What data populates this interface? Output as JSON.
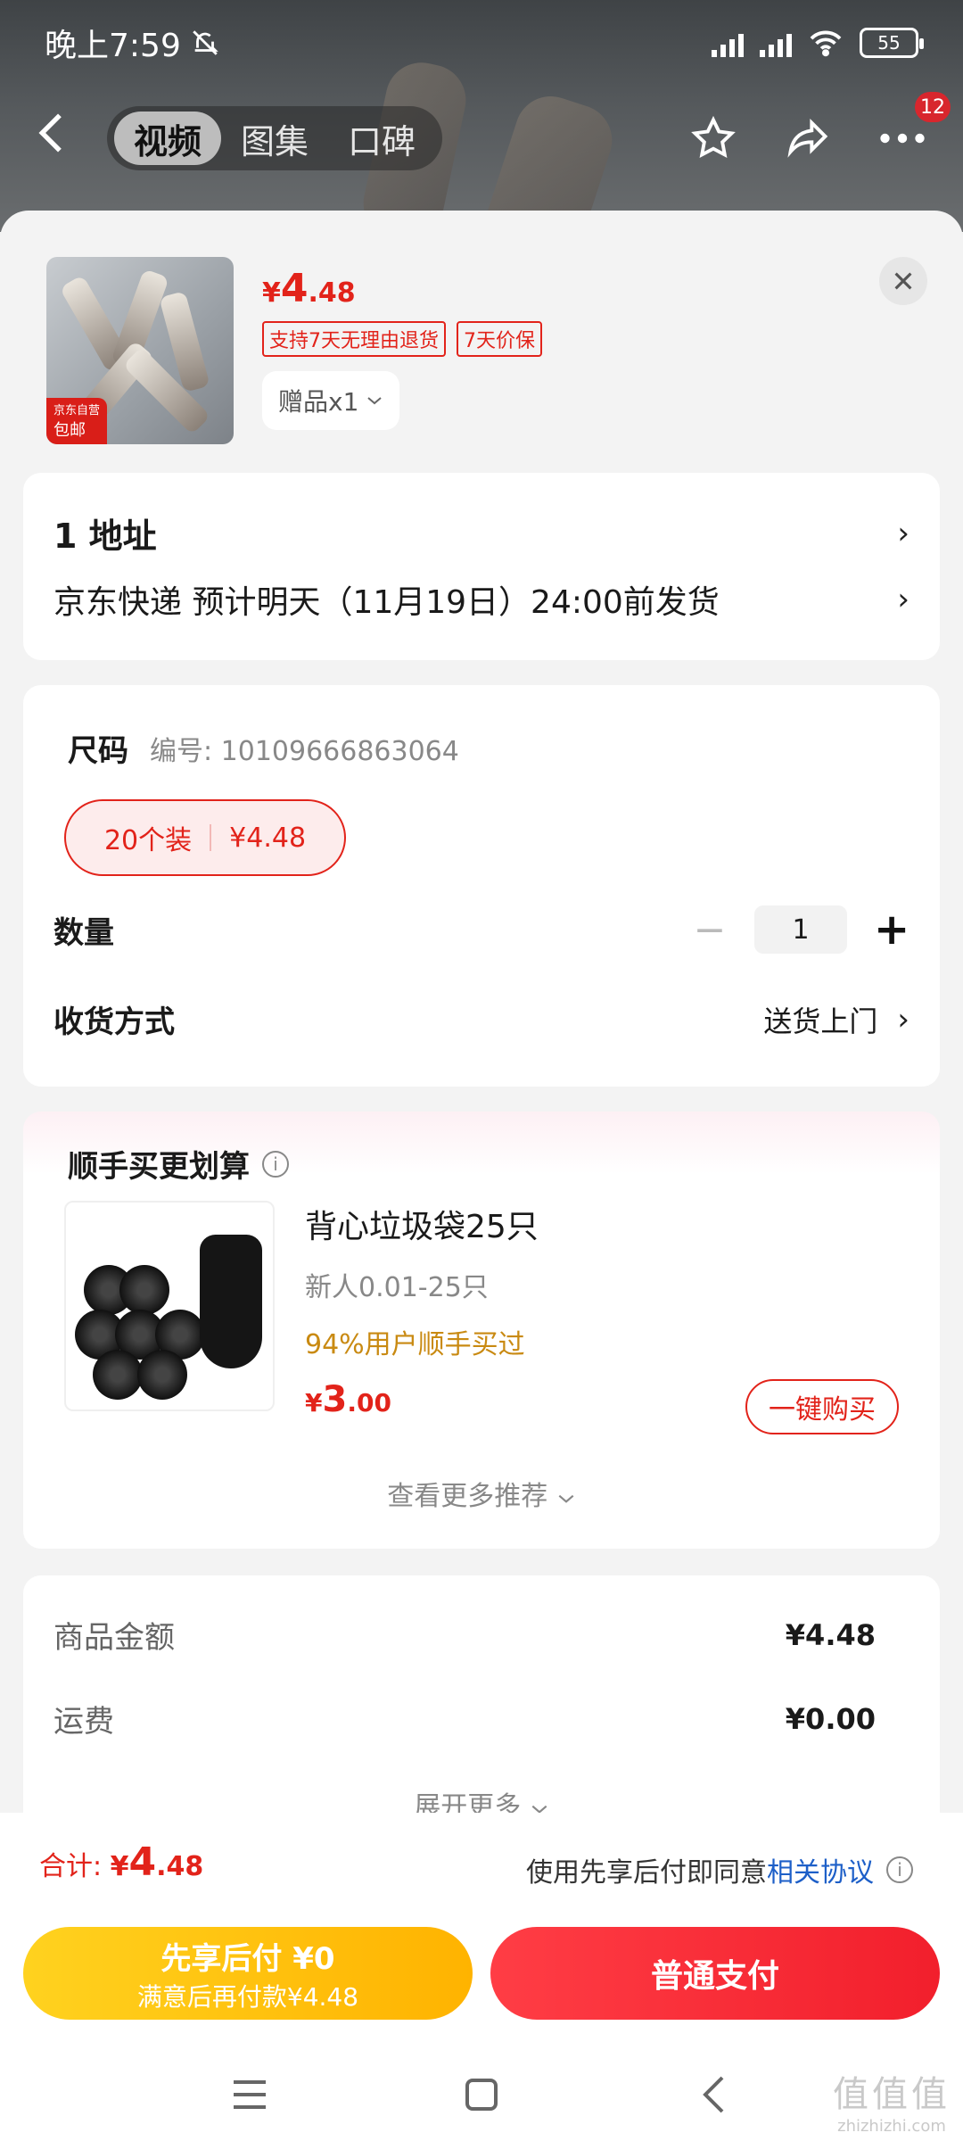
{
  "status_bar": {
    "time": "晚上7:59",
    "battery": "55"
  },
  "nav": {
    "tabs": [
      "视频",
      "图集",
      "口碑"
    ],
    "active_tab": 0,
    "cart_badge": "12"
  },
  "product": {
    "price": {
      "currency": "¥",
      "int": "4",
      "dec": ".48"
    },
    "chips": [
      "支持7天无理由退货",
      "7天价保"
    ],
    "thumb_tags": [
      "京东自营",
      "包邮"
    ],
    "gift": "赠品x1"
  },
  "address": {
    "title": "1  地址",
    "delivery": "京东快递  预计明天（11月19日）24:00前发货"
  },
  "spec": {
    "size_label": "尺码",
    "code": "编号: 10109666863064",
    "option_name": "20个装",
    "option_price": "¥4.48",
    "qty_label": "数量",
    "qty_value": "1",
    "qty_minus": "−",
    "qty_plus": "+",
    "ship_label": "收货方式",
    "ship_value": "送货上门"
  },
  "recommend": {
    "title": "顺手买更划算",
    "item_name": "背心垃圾袋25只",
    "item_sub": "新人0.01-25只",
    "item_buyers": "94%用户顺手买过",
    "item_price": {
      "currency": "¥",
      "int": "3",
      "dec": ".00"
    },
    "buy_button": "一键购买",
    "more": "查看更多推荐"
  },
  "summary": {
    "goods_label": "商品金额",
    "goods_value": "¥4.48",
    "ship_label": "运费",
    "ship_value": "¥0.00",
    "expand": "展开更多"
  },
  "footer": {
    "total_label": "合计: ",
    "total": {
      "currency": "¥",
      "int": "4",
      "dec": ".48"
    },
    "agree_text": "使用先享后付即同意",
    "agree_link": "相关协议",
    "later_title": "先享后付 ¥0",
    "later_sub": "满意后再付款¥4.48",
    "pay_button": "普通支付"
  },
  "watermark": {
    "big": "值值值",
    "small": "zhizhizhi.com"
  },
  "colors": {
    "accent": "#e2231a",
    "link": "#1d5fc8",
    "gold": "#c98a12"
  }
}
